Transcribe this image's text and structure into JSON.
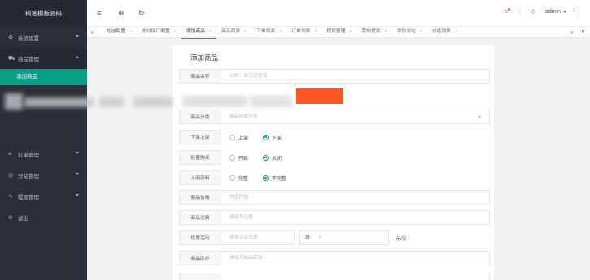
{
  "sidebar": {
    "brand": "稿笔模板源码",
    "items": [
      {
        "label": "系统设置",
        "icon": "gear-icon",
        "glyph": "⚙",
        "caret": "down"
      },
      {
        "label": "商品管理",
        "icon": "cart-icon",
        "glyph": "⛟",
        "caret": "up",
        "open": true
      },
      {
        "label": "订单管理",
        "icon": "list-icon",
        "glyph": "≡",
        "caret": "down"
      },
      {
        "label": "分站管理",
        "icon": "globe-icon",
        "glyph": "◎",
        "caret": "down"
      },
      {
        "label": "提现管理",
        "icon": "chart-icon",
        "glyph": "∿",
        "caret": "down"
      },
      {
        "label": "退出",
        "icon": "logout-icon",
        "glyph": "⊘"
      }
    ],
    "sub_item": "添加商品"
  },
  "header": {
    "menu_glyph": "≡",
    "globe_glyph": "⊕",
    "refresh_glyph": "↻",
    "bell_glyph": "♫",
    "skin_glyph": "◌",
    "tag_glyph": "◇",
    "user": "admin",
    "more_glyph": "⋮"
  },
  "tabs": {
    "prev_glyph": "«",
    "next_glyph": "»",
    "expand_glyph": "∨",
    "close_glyph": "×",
    "items": [
      {
        "label": "短信配置"
      },
      {
        "label": "支付接口配置"
      },
      {
        "label": "添加商品",
        "active": true
      },
      {
        "label": "商品列表"
      },
      {
        "label": "工单列表"
      },
      {
        "label": "订单列表"
      },
      {
        "label": "提现管理"
      },
      {
        "label": "我的提现"
      },
      {
        "label": "添加分站"
      },
      {
        "label": "分站列表"
      }
    ]
  },
  "form": {
    "title": "添加商品",
    "name_label": "商品名称",
    "name_placeholder": "示例：百万豆豆鸟",
    "category_label": "商品分类",
    "category_placeholder": "商品所属分类",
    "stock_label": "下架上架",
    "stock_opt_a": "上架",
    "stock_opt_b": "下架",
    "bulk_label": "批量购买",
    "bulk_opt_a": "开启",
    "bulk_opt_b": "关闭",
    "entry_label": "入网资料",
    "entry_opt_a": "完整",
    "entry_opt_b": "不完整",
    "price_label": "商品价格",
    "price_placeholder": "充值价格",
    "ship_label": "商品运费",
    "ship_placeholder": "请填写运费",
    "promo_label": "优惠活动",
    "promo_placeholder": "满多少后优惠",
    "promo_mid": "减 -",
    "promo_amount": "0",
    "promo_unit": "元/张",
    "inventory_label": "商品库存",
    "inventory_placeholder": "请填写商品库存"
  }
}
